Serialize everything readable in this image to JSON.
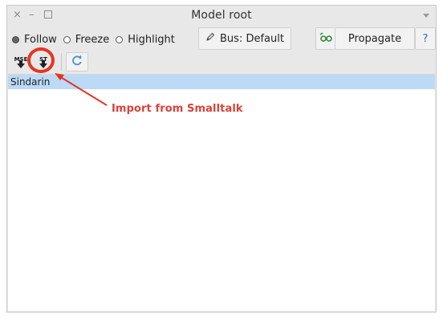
{
  "window": {
    "title": "Model root",
    "close_glyph": "×",
    "minimize_glyph": "–"
  },
  "mode": {
    "options": [
      {
        "label": "Follow",
        "selected": true
      },
      {
        "label": "Freeze",
        "selected": false
      },
      {
        "label": "Highlight",
        "selected": false
      }
    ]
  },
  "toolbar": {
    "bus_label": "Bus: Default",
    "bus_icon": "pencil-icon",
    "glasses_icon": "glasses-icon",
    "propagate_label": "Propagate",
    "help_label": "?",
    "import_mse_label": "MSE",
    "import_st_label": "ST",
    "refresh_icon": "refresh-icon"
  },
  "list": {
    "items": [
      "Sindarin"
    ]
  },
  "annotation": {
    "text": "Import from Smalltalk",
    "color": "#d9423a"
  },
  "colors": {
    "selection": "#bcd9f6",
    "accent_red": "#e53522",
    "help_blue": "#2a6fb5"
  }
}
